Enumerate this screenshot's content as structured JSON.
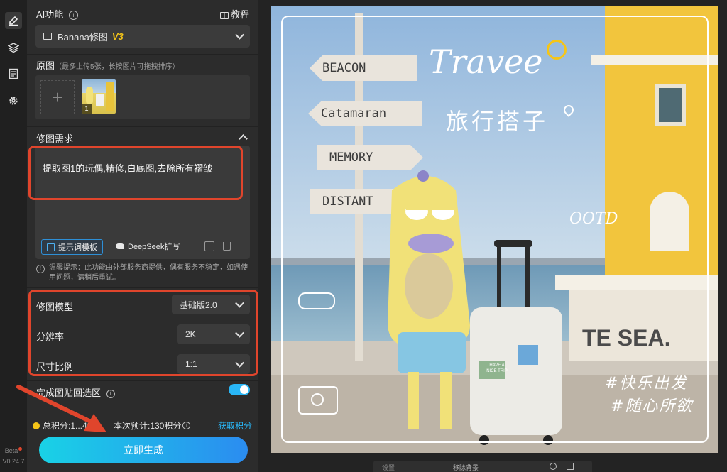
{
  "rail": {
    "version_tag": "Beta",
    "version": "V0.24.7"
  },
  "panel": {
    "ai_section_title": "AI功能",
    "tutorial_label": "教程",
    "feature_select_value": "Banana修图",
    "feature_select_badge": "V3",
    "original_title": "原图",
    "original_note": "（最多上传5张，长按图片可拖拽排序）",
    "thumb_index": "1",
    "requirements_title": "修图需求",
    "prompt_text": "提取图1的玩偶,精修,白底图,去除所有褶皱",
    "prompt_template_label": "提示词模板",
    "deepseek_label": "DeepSeek扩写",
    "tip_text": "温馨提示：此功能由外部服务商提供，偶有服务不稳定，如遇使用问题，请稍后重试。",
    "settings": [
      {
        "label": "修图模型",
        "value": "基础版2.0"
      },
      {
        "label": "分辨率",
        "value": "2K"
      },
      {
        "label": "尺寸比例",
        "value": "1:1"
      }
    ],
    "paste_back_label": "完成图贴回选区",
    "points_total_prefix": "总积分:",
    "points_total_value": "1...49",
    "points_estimate": "本次预计:130积分",
    "get_points_label": "获取积分",
    "generate_label": "立即生成"
  },
  "photo": {
    "signs": [
      "BEACON",
      "Catamaran",
      "MEMORY",
      "DISTANT"
    ],
    "headline": "Travee",
    "subtitle": "旅行搭子",
    "ootd": "OOTD",
    "sea_text": "TE SEA.",
    "tag1": "#快乐出发",
    "tag2": "#随心所欲",
    "sticker": "HAVE A NICE TRIP"
  },
  "bottom_toolbar": {
    "left_label": "设置",
    "right_label": "移除背景"
  },
  "colors": {
    "accent_blue": "#29b6f6",
    "highlight_red": "#e0452c",
    "badge_yellow": "#f5c518",
    "panel_bg": "#2c2c2c"
  }
}
